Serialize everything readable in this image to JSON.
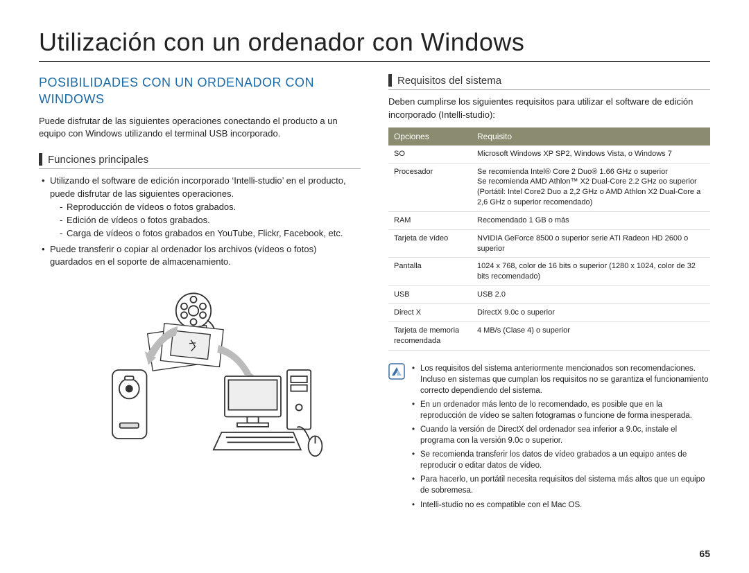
{
  "pageTitle": "Utilización con un ordenador con Windows",
  "left": {
    "heading": "POSIBILIDADES CON UN ORDENADOR CON WINDOWS",
    "intro": "Puede disfrutar de las siguientes operaciones conectando el producto a un equipo con Windows utilizando el terminal USB incorporado.",
    "subheading": "Funciones principales",
    "b1_lead": "Utilizando el software de edición incorporado ‘Intelli-studio’ en el producto, puede disfrutar de las siguientes operaciones.",
    "b1_d1": "Reproducción de vídeos o fotos grabados.",
    "b1_d2": "Edición de vídeos o fotos grabados.",
    "b1_d3": "Carga de vídeos o fotos grabados en YouTube, Flickr, Facebook, etc.",
    "b2": "Puede transferir o copiar al ordenador los archivos (vídeos o fotos) guardados en el soporte de almacenamiento."
  },
  "right": {
    "subheading": "Requisitos del sistema",
    "intro": "Deben cumplirse los siguientes requisitos para utilizar el software de edición incorporado (Intelli-studio):",
    "table": {
      "headers": {
        "opciones": "Opciones",
        "requisito": "Requisito"
      },
      "rows": [
        {
          "k": "SO",
          "v": "Microsoft Windows XP SP2, Windows Vista, o Windows 7"
        },
        {
          "k": "Procesador",
          "v": "Se recomienda Intel® Core 2 Duo® 1.66 GHz o superior\nSe recomienda AMD Athlon™ X2 Dual-Core 2.2 GHz oo superior\n(Portátil: Intel Core2 Duo a 2,2 GHz o AMD Athlon X2 Dual-Core a 2,6 GHz o superior recomendado)"
        },
        {
          "k": "RAM",
          "v": "Recomendado 1 GB o más"
        },
        {
          "k": "Tarjeta de vídeo",
          "v": "NVIDIA GeForce 8500 o superior serie ATI Radeon HD 2600 o superior"
        },
        {
          "k": "Pantalla",
          "v": "1024 x 768, color de 16 bits o superior (1280 x 1024, color de 32 bits recomendado)"
        },
        {
          "k": "USB",
          "v": "USB 2.0"
        },
        {
          "k": "Direct X",
          "v": "DirectX 9.0c o superior"
        },
        {
          "k": "Tarjeta de memoria recomendada",
          "v": "4 MB/s (Clase 4) o superior"
        }
      ]
    },
    "notes": [
      "Los requisitos del sistema anteriormente mencionados son recomendaciones. Incluso en sistemas que cumplan los requisitos no se garantiza el funcionamiento correcto dependiendo del sistema.",
      "En un ordenador más lento de lo recomendado, es posible que en la reproducción de vídeo se salten fotogramas o funcione de forma inesperada.",
      "Cuando la versión de DirectX del ordenador sea inferior a 9.0c, instale el programa con la versión 9.0c o superior.",
      "Se recomienda transferir los datos de vídeo grabados a un equipo antes de reproducir o editar datos de vídeo.",
      "Para hacerlo, un portátil necesita requisitos del sistema más altos que un equipo de sobremesa.",
      "Intelli-studio no es compatible con el Mac OS."
    ]
  },
  "pageNumber": "65"
}
